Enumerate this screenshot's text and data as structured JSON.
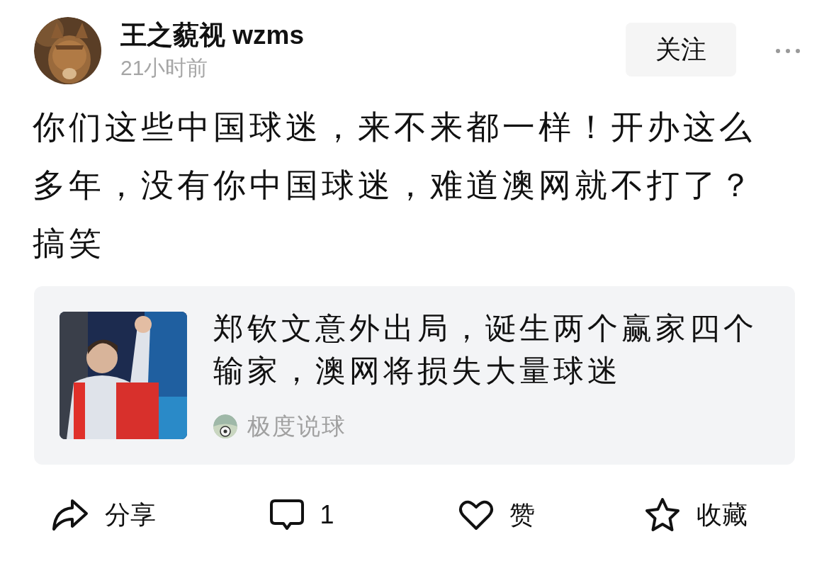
{
  "post": {
    "author": "王之藐视 wzms",
    "time": "21小时前",
    "follow_button": "关注",
    "text": "你们这些中国球迷，来不来都一样！开办这么多年，没有你中国球迷，难道澳网就不打了？搞笑",
    "linked_article": {
      "title": "郑钦文意外出局，诞生两个赢家四个输家，澳网将损失大量球迷",
      "source": "极度说球"
    },
    "actions": [
      {
        "kind": "share",
        "label": "分享"
      },
      {
        "kind": "comment",
        "label": "1"
      },
      {
        "kind": "like",
        "label": "赞"
      },
      {
        "kind": "favorite",
        "label": "收藏"
      }
    ]
  }
}
